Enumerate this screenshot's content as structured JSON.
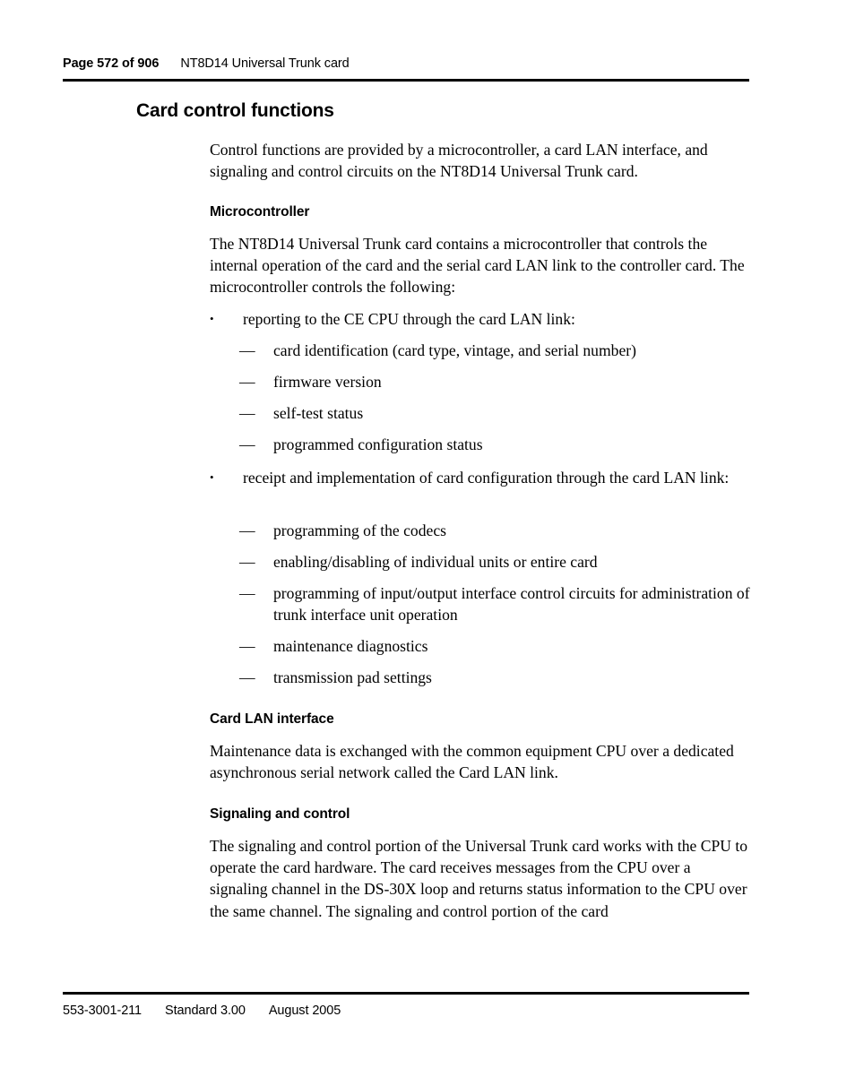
{
  "header": {
    "page_label": "Page 572 of 906",
    "document_title": "NT8D14 Universal Trunk card"
  },
  "footer": {
    "doc_number": "553-3001-211",
    "standard": "Standard 3.00",
    "date": "August 2005"
  },
  "content": {
    "heading": "Card control functions",
    "intro": "Control functions are provided by a microcontroller, a card LAN interface, and signaling and control circuits on the NT8D14 Universal Trunk card.",
    "sections": [
      {
        "heading": "Microcontroller",
        "paragraph": "The NT8D14 Universal Trunk card contains a microcontroller that controls the internal operation of the card and the serial card LAN link to the controller card. The microcontroller controls the following:",
        "bullets": [
          {
            "marker": "•",
            "text": "reporting to the CE CPU through the card LAN link:",
            "subitems": [
              {
                "marker": "—",
                "text": "card identification (card type, vintage, and serial number)"
              },
              {
                "marker": "—",
                "text": "firmware version"
              },
              {
                "marker": "—",
                "text": "self-test status"
              },
              {
                "marker": "—",
                "text": "programmed configuration status"
              }
            ]
          },
          {
            "marker": "•",
            "text": "receipt and implementation of card configuration through the card LAN link:",
            "subitems": [
              {
                "marker": "—",
                "text": "programming of the codecs"
              },
              {
                "marker": "—",
                "text": "enabling/disabling of individual units or entire card"
              },
              {
                "marker": "—",
                "text": "programming of input/output interface control circuits for administration of trunk interface unit operation"
              },
              {
                "marker": "—",
                "text": "maintenance diagnostics"
              },
              {
                "marker": "—",
                "text": "transmission pad settings"
              }
            ]
          }
        ]
      },
      {
        "heading": "Card LAN interface",
        "paragraph": "Maintenance data is exchanged with the common equipment CPU over a dedicated asynchronous serial network called the Card LAN link."
      },
      {
        "heading": "Signaling and control",
        "paragraph": "The signaling and control portion of the Universal Trunk card works with the CPU to operate the card hardware. The card receives messages from the CPU over a signaling channel in the DS-30X loop and returns status information to the CPU over the same channel. The signaling and control portion of the card"
      }
    ]
  }
}
